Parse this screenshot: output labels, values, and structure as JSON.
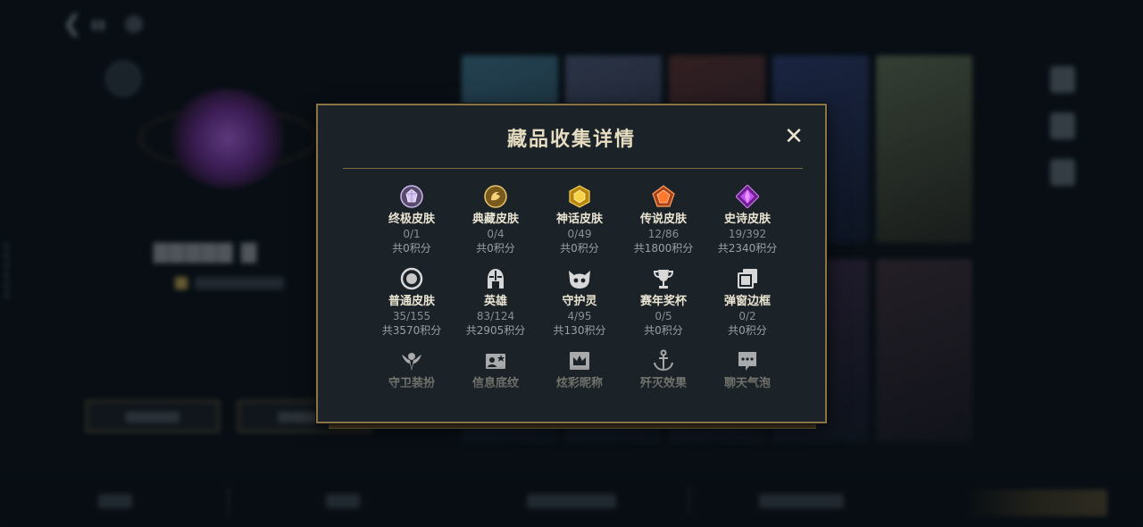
{
  "modal": {
    "title": "藏品收集详情",
    "close_glyph": "✕",
    "rows": [
      [
        {
          "label": "终极皮肤",
          "count": "0/1",
          "points": "共0积分",
          "icon": "ultimate-skin-icon"
        },
        {
          "label": "典藏皮肤",
          "count": "0/4",
          "points": "共0积分",
          "icon": "prestige-skin-icon"
        },
        {
          "label": "神话皮肤",
          "count": "0/49",
          "points": "共0积分",
          "icon": "mythic-skin-icon"
        },
        {
          "label": "传说皮肤",
          "count": "12/86",
          "points": "共1800积分",
          "icon": "legendary-skin-icon"
        },
        {
          "label": "史诗皮肤",
          "count": "19/392",
          "points": "共2340积分",
          "icon": "epic-skin-icon"
        }
      ],
      [
        {
          "label": "普通皮肤",
          "count": "35/155",
          "points": "共3570积分",
          "icon": "standard-skin-icon"
        },
        {
          "label": "英雄",
          "count": "83/124",
          "points": "共2905积分",
          "icon": "champion-helmet-icon"
        },
        {
          "label": "守护灵",
          "count": "4/95",
          "points": "共130积分",
          "icon": "guardian-pet-icon"
        },
        {
          "label": "赛年奖杯",
          "count": "0/5",
          "points": "共0积分",
          "icon": "trophy-icon"
        },
        {
          "label": "弹窗边框",
          "count": "0/2",
          "points": "共0积分",
          "icon": "popup-frame-icon"
        }
      ],
      [
        {
          "label": "守卫装扮",
          "icon": "ward-skin-icon"
        },
        {
          "label": "信息底纹",
          "icon": "info-card-icon"
        },
        {
          "label": "炫彩昵称",
          "icon": "crown-nickname-icon"
        },
        {
          "label": "歼灭效果",
          "icon": "anchor-effect-icon"
        },
        {
          "label": "聊天气泡",
          "icon": "chat-bubble-icon"
        }
      ]
    ]
  },
  "colors": {
    "gold_border": "#8a7443",
    "panel_bg": "#1b2228",
    "title_text": "#e6dcc0"
  }
}
